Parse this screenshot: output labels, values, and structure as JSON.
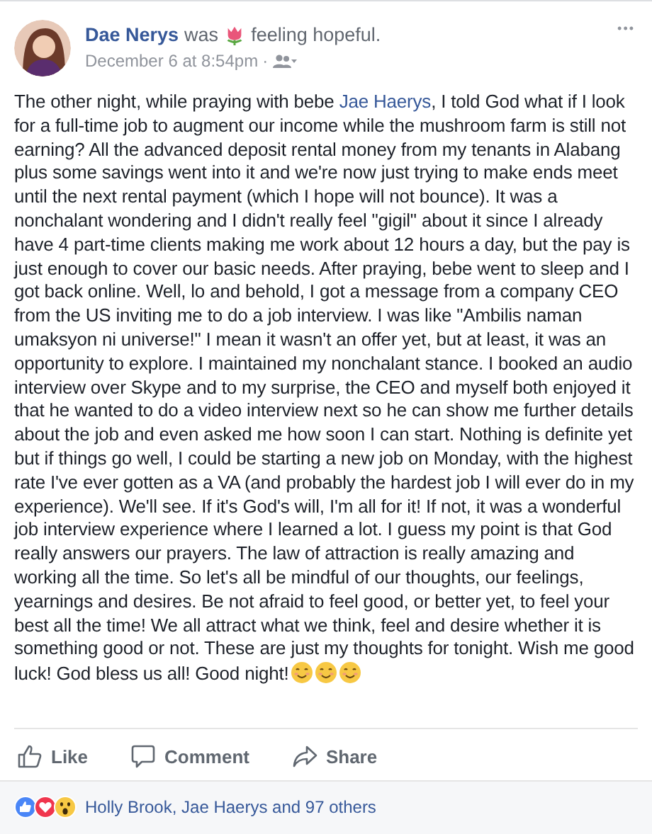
{
  "post": {
    "author": "Dae Nerys",
    "activity_verb": "was",
    "feeling": {
      "kind": "tulip",
      "text": "feeling hopeful."
    },
    "timestamp": "December 6 at 8:54pm",
    "separator": "·",
    "audience": {
      "kind": "friends"
    },
    "more": "•••",
    "body": [
      {
        "kind": "text",
        "text": "The other night, while praying with bebe "
      },
      {
        "kind": "mention",
        "text": "Jae Haerys"
      },
      {
        "kind": "text",
        "text": ", I told God what if I look for a full-time job to augment our income while the mushroom farm is still not earning? All the advanced deposit rental money from my tenants in Alabang plus some savings went into it and we're now just trying to make ends meet until the next rental payment (which I hope will not bounce). It was a nonchalant wondering and I didn't really feel \"gigil\" about it since I already have 4 part-time clients making me work about 12 hours a day, but the pay is just enough to cover our basic needs. After praying, bebe went to sleep and I got back online. Well, lo and behold, I got a message from a company CEO from the US inviting me to do a job interview. I was like \"Ambilis naman umaksyon ni universe!\" I mean it wasn't an offer yet, but at least, it was an opportunity to explore. I maintained my nonchalant stance. I booked an audio interview over Skype and to my surprise, the CEO and myself both enjoyed it that he wanted to do a video interview next so he can show me further details about the job and even asked me how soon I can start. Nothing is definite yet but if things go well, I could be starting a new job on Monday, with the highest rate I've ever gotten as a VA (and probably the hardest job I will ever do in my experience). We'll see. If it's God's will, I'm all for it! If not, it was a wonderful job interview experience where I learned a lot. I guess my point is that God really answers our prayers. The law of attraction is really amazing and working all the time. So let's all be mindful of our thoughts, our feelings, yearnings and desires. Be not afraid to feel good, or better yet, to feel your best all the time! We all attract what we think, feel and desire whether it is something good or not. These are just my thoughts for tonight. Wish me good luck! God bless us all! Good night!"
      }
    ],
    "end_emoji": [
      {
        "kind": "smile"
      },
      {
        "kind": "smile"
      },
      {
        "kind": "smile"
      }
    ]
  },
  "actions": [
    {
      "kind": "like",
      "label": "Like"
    },
    {
      "kind": "comment",
      "label": "Comment"
    },
    {
      "kind": "share",
      "label": "Share"
    }
  ],
  "reactions": {
    "icons": [
      {
        "kind": "like"
      },
      {
        "kind": "love"
      },
      {
        "kind": "wow"
      }
    ],
    "summary": "Holly Brook, Jae Haerys and 97 others"
  }
}
